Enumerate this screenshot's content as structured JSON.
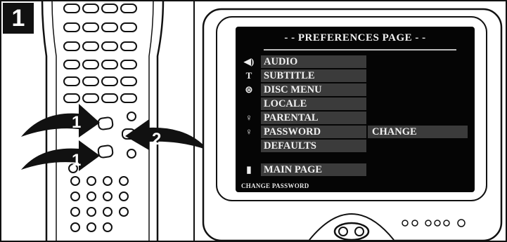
{
  "step": {
    "number": "1"
  },
  "remote": {
    "arrows": [
      {
        "label": "1"
      },
      {
        "label": "2"
      },
      {
        "label": "1"
      }
    ]
  },
  "screen": {
    "title": "- - PREFERENCES PAGE - -",
    "menu_items": [
      {
        "label": "AUDIO",
        "icon": "speaker-icon",
        "glyph": "◀)"
      },
      {
        "label": "SUBTITLE",
        "icon": "subtitle-icon",
        "glyph": "T"
      },
      {
        "label": "DISC MENU",
        "icon": "disc-menu-icon",
        "glyph": "⊜"
      },
      {
        "label": "LOCALE",
        "icon": "",
        "glyph": ""
      },
      {
        "label": "PARENTAL",
        "icon": "key-icon",
        "glyph": "♀"
      },
      {
        "label": "PASSWORD",
        "icon": "key-icon",
        "glyph": "♀"
      },
      {
        "label": "DEFAULTS",
        "icon": "",
        "glyph": ""
      },
      {
        "label": "MAIN PAGE",
        "icon": "door-icon",
        "glyph": "▮"
      }
    ],
    "submenu": {
      "label": "CHANGE"
    },
    "status": "CHANGE PASSWORD"
  }
}
